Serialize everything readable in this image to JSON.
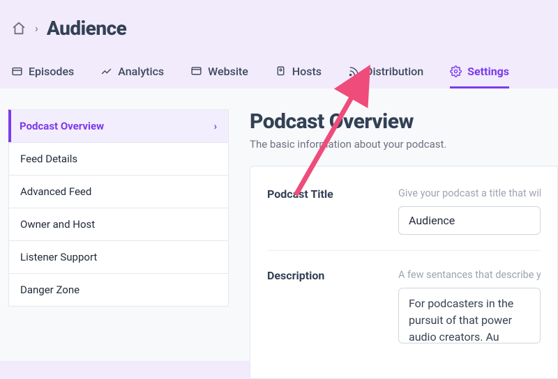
{
  "breadcrumb": {
    "title": "Audience"
  },
  "tabs": [
    {
      "label": "Episodes",
      "icon": "episodes"
    },
    {
      "label": "Analytics",
      "icon": "analytics"
    },
    {
      "label": "Website",
      "icon": "website"
    },
    {
      "label": "Hosts",
      "icon": "hosts"
    },
    {
      "label": "Distribution",
      "icon": "distribution"
    },
    {
      "label": "Settings",
      "icon": "settings",
      "active": true
    }
  ],
  "sidebar": {
    "items": [
      {
        "label": "Podcast Overview",
        "active": true
      },
      {
        "label": "Feed Details"
      },
      {
        "label": "Advanced Feed"
      },
      {
        "label": "Owner and Host"
      },
      {
        "label": "Listener Support"
      },
      {
        "label": "Danger Zone"
      }
    ]
  },
  "content": {
    "heading": "Podcast Overview",
    "subtitle": "The basic information about your podcast.",
    "fields": {
      "title": {
        "label": "Podcast Title",
        "hint": "Give your podcast a title that will hel",
        "value": "Audience"
      },
      "description": {
        "label": "Description",
        "hint": "A few sentances that describe your s",
        "value": "For podcasters in the pursuit of that power audio creators. Au Respect the craft of audio – su"
      }
    }
  }
}
